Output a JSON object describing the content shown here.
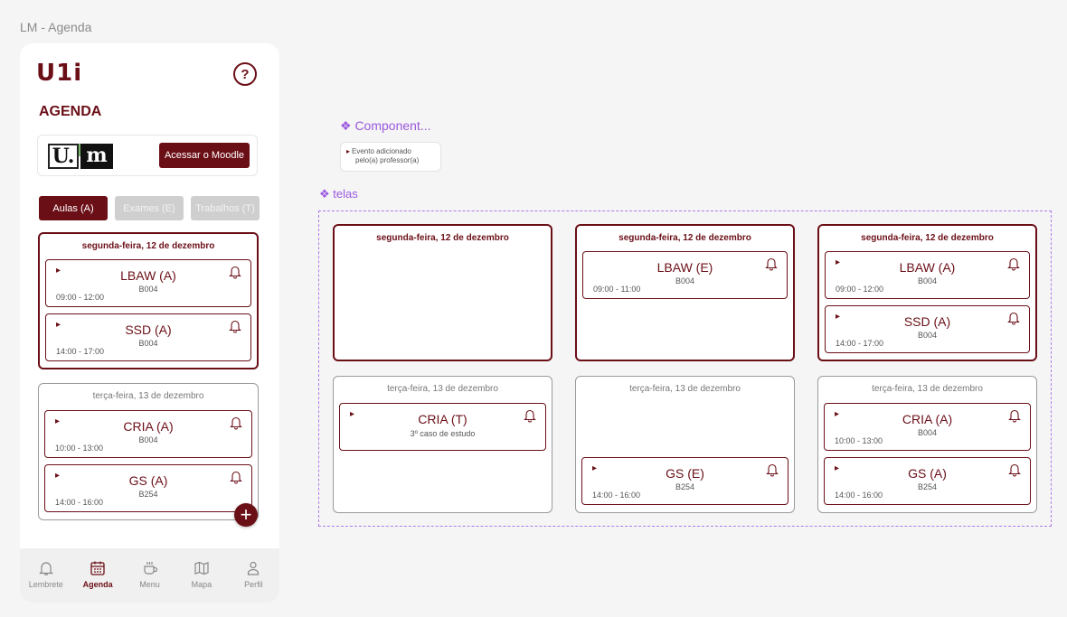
{
  "window_title": "LM - Agenda",
  "app": {
    "logo": "U1i",
    "help_glyph": "?",
    "page_title": "AGENDA",
    "moodle": {
      "logo_u": "U.",
      "logo_m": "m",
      "button": "Acessar o Moodle"
    },
    "tabs": [
      {
        "label": "Aulas (A)",
        "active": true
      },
      {
        "label": "Exames (E)",
        "active": false
      },
      {
        "label": "Trabalhos (T)",
        "active": false
      }
    ],
    "days": [
      {
        "title": "segunda-feira, 12 de dezembro",
        "events": [
          {
            "flag": "▸",
            "name": "LBAW (A)",
            "room": "B004",
            "time": "09:00 - 12:00"
          },
          {
            "flag": "▸",
            "name": "SSD (A)",
            "room": "B004",
            "time": "14:00 - 17:00"
          }
        ]
      },
      {
        "title": "terça-feira, 13 de dezembro",
        "events": [
          {
            "flag": "▸",
            "name": "CRIA (A)",
            "room": "B004",
            "time": "10:00 - 13:00"
          },
          {
            "flag": "▸",
            "name": "GS (A)",
            "room": "B254",
            "time": "14:00 - 16:00"
          }
        ]
      }
    ],
    "fab": "+",
    "nav": [
      {
        "label": "Lembrete",
        "icon": "bell-icon",
        "active": false
      },
      {
        "label": "Agenda",
        "icon": "calendar-icon",
        "active": true
      },
      {
        "label": "Menu",
        "icon": "coffee-icon",
        "active": false
      },
      {
        "label": "Mapa",
        "icon": "map-icon",
        "active": false
      },
      {
        "label": "Perfil",
        "icon": "user-icon",
        "active": false
      }
    ]
  },
  "component": {
    "title": "❖ Component...",
    "line1": "Evento adicionado",
    "line2": "pelo(a) professor(a)"
  },
  "telas": {
    "title": "❖ telas",
    "screens": [
      {
        "title": "segunda-feira, 12 de dezembro",
        "selected": true,
        "events": []
      },
      {
        "title": "segunda-feira, 12 de dezembro",
        "selected": true,
        "events": [
          {
            "name": "LBAW (E)",
            "room": "B004",
            "time": "09:00 - 11:00"
          }
        ]
      },
      {
        "title": "segunda-feira, 12 de dezembro",
        "selected": true,
        "events": [
          {
            "name": "LBAW (A)",
            "room": "B004",
            "time": "09:00 - 12:00"
          },
          {
            "name": "SSD (A)",
            "room": "B004",
            "time": "14:00 - 17:00"
          }
        ]
      },
      {
        "title": "terça-feira, 13 de dezembro",
        "selected": false,
        "events": [
          {
            "name": "CRIA (T)",
            "room": "3º caso de estudo",
            "time": ""
          }
        ]
      },
      {
        "title": "terça-feira, 13 de dezembro",
        "selected": false,
        "events": [
          {
            "name": "GS (E)",
            "room": "B254",
            "time": "14:00 - 16:00"
          }
        ]
      },
      {
        "title": "terça-feira, 13 de dezembro",
        "selected": false,
        "events": [
          {
            "name": "CRIA (A)",
            "room": "B004",
            "time": "10:00 - 13:00"
          },
          {
            "name": "GS (A)",
            "room": "B254",
            "time": "14:00 - 16:00"
          }
        ]
      }
    ]
  },
  "colors": {
    "brand": "#6b0f17",
    "accent": "#9b59e0",
    "inactive_tab": "#cfcfcf"
  }
}
